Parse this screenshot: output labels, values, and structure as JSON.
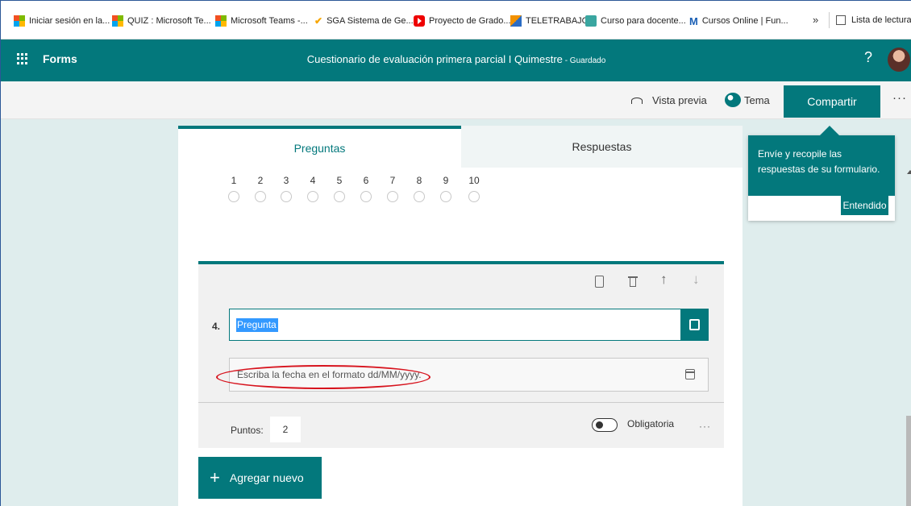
{
  "bookmarks": [
    {
      "label": "Iniciar sesión en la...",
      "icon": "microsoft-icon"
    },
    {
      "label": "QUIZ : Microsoft Te...",
      "icon": "microsoft-icon"
    },
    {
      "label": "Microsoft Teams -...",
      "icon": "microsoft-icon"
    },
    {
      "label": "SGA Sistema de Ge...",
      "icon": "sga-icon"
    },
    {
      "label": "Proyecto de Grado...",
      "icon": "youtube-icon"
    },
    {
      "label": "TELETRABAJO",
      "icon": "teletrabajo-icon"
    },
    {
      "label": "Curso para docente...",
      "icon": "course-icon"
    },
    {
      "label": "Cursos Online | Fun...",
      "icon": "m-icon"
    }
  ],
  "bookmarks_more": "»",
  "reading_list": "Lista de lectura",
  "header": {
    "app_name": "Forms",
    "title": "Cuestionario de evaluación primera parcial I Quimestre",
    "status": " - Guardado",
    "help": "?"
  },
  "toolbar": {
    "preview": "Vista previa",
    "theme": "Tema",
    "share": "Compartir",
    "more": "···"
  },
  "tabs": {
    "questions": "Preguntas",
    "responses": "Respuestas"
  },
  "scale": [
    "1",
    "2",
    "3",
    "4",
    "5",
    "6",
    "7",
    "8",
    "9",
    "10"
  ],
  "question": {
    "number": "4.",
    "text": "Pregunta",
    "date_placeholder": "Escriba la fecha en el formato dd/MM/yyyy.",
    "points_label": "Puntos:",
    "points_value": "2",
    "required_label": "Obligatoria",
    "more": "···"
  },
  "add_new": "Agregar nuevo",
  "tooltip": {
    "text": "Envíe y recopile las respuestas de su formulario.",
    "button": "Entendido"
  },
  "colors": {
    "accent": "#03787c",
    "page_bg": "#dfeded",
    "highlight": "#d7141e"
  }
}
